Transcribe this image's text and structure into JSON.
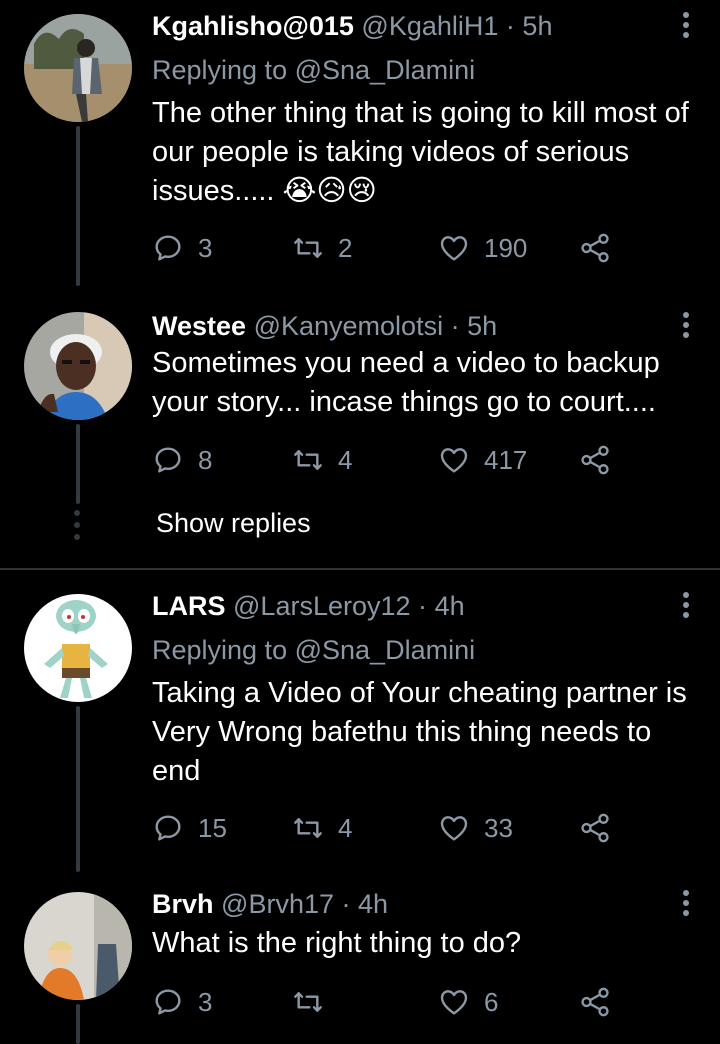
{
  "tweets": [
    {
      "name": "Kgahlisho@015",
      "handle": "@KgahliH1",
      "time": "5h",
      "replying_label": "Replying to",
      "replying_to": "@Sna_Dlamini",
      "text": "The other thing that is going to kill most of our people is taking videos of serious issues..... 😭😥😢",
      "replies": "3",
      "retweets": "2",
      "likes": "190"
    },
    {
      "name": "Westee",
      "handle": "@Kanyemolotsi",
      "time": "5h",
      "text": "Sometimes you need a video to backup your story... incase things go to court....",
      "replies": "8",
      "retweets": "4",
      "likes": "417"
    },
    {
      "name": "LARS",
      "handle": "@LarsLeroy12",
      "time": "4h",
      "replying_label": "Replying to",
      "replying_to": "@Sna_Dlamini",
      "text": "Taking a Video of Your cheating partner is Very Wrong bafethu this thing needs to end",
      "replies": "15",
      "retweets": "4",
      "likes": "33"
    },
    {
      "name": "Brvh",
      "handle": "@Brvh17",
      "time": "4h",
      "text": "What is the right thing to do?",
      "replies": "3",
      "retweets": "",
      "likes": "6"
    }
  ],
  "show_replies": "Show replies",
  "separator": "·",
  "icons": [
    "reply-icon",
    "retweet-icon",
    "like-icon",
    "share-icon",
    "more-icon"
  ],
  "colors": {
    "background": "#000000",
    "secondary_text": "#8b98a5",
    "thread_line": "#333a40"
  }
}
